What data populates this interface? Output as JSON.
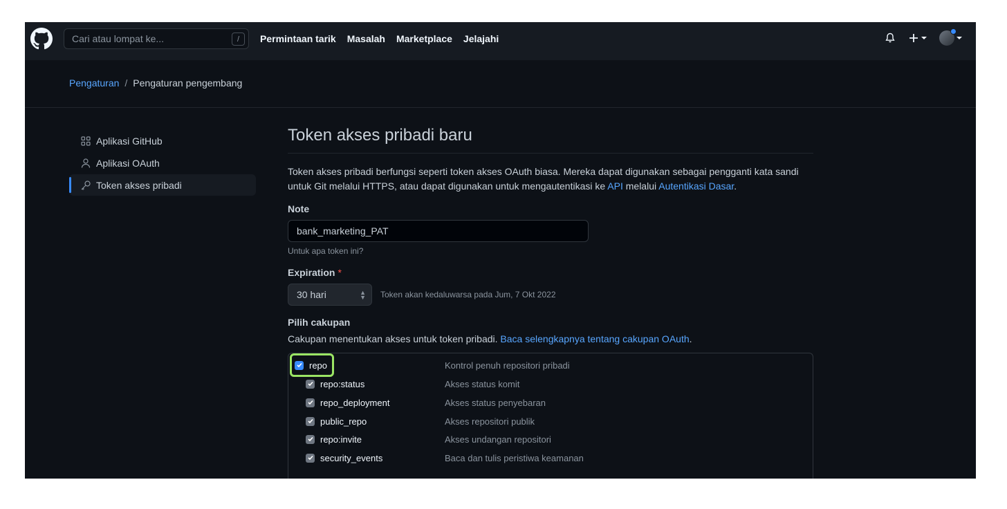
{
  "header": {
    "search_placeholder": "Cari atau lompat ke...",
    "search_shortcut": "/",
    "nav": [
      "Permintaan tarik",
      "Masalah",
      "Marketplace",
      "Jelajahi"
    ]
  },
  "breadcrumb": {
    "parent": "Pengaturan",
    "separator": "/",
    "current": "Pengaturan pengembang"
  },
  "sidebar": {
    "items": [
      {
        "label": "Aplikasi GitHub",
        "icon": "apps-icon",
        "active": false
      },
      {
        "label": "Aplikasi OAuth",
        "icon": "person-icon",
        "active": false
      },
      {
        "label": "Token akses pribadi",
        "icon": "key-icon",
        "active": true
      }
    ]
  },
  "main": {
    "title": "Token akses pribadi baru",
    "intro_text": "Token akses pribadi berfungsi seperti token akses OAuth biasa. Mereka dapat digunakan sebagai pengganti kata sandi untuk Git melalui HTTPS, atau dapat digunakan untuk mengautentikasi ke",
    "intro_link_api": "API",
    "intro_mid": "melalui",
    "intro_link_basic": "Autentikasi Dasar",
    "intro_end": ".",
    "note_label": "Note",
    "note_value": "bank_marketing_PAT",
    "note_hint": "Untuk apa token ini?",
    "expiration_label": "Expiration",
    "required_mark": "*",
    "expiration_value": "30 hari",
    "expiration_note": "Token akan kedaluwarsa pada Jum, 7 Okt 2022",
    "scopes_label": "Pilih cakupan",
    "scopes_lead": "Cakupan menentukan akses untuk token pribadi.",
    "scopes_link": "Baca selengkapnya tentang cakupan OAuth",
    "scopes_lead_end": "."
  },
  "scopes": [
    {
      "name": "repo",
      "desc": "Kontrol penuh repositori pribadi",
      "checked": true,
      "parent": true
    },
    {
      "name": "repo:status",
      "desc": "Akses status komit",
      "checked": true,
      "parent": false
    },
    {
      "name": "repo_deployment",
      "desc": "Akses status penyebaran",
      "checked": true,
      "parent": false
    },
    {
      "name": "public_repo",
      "desc": "Akses repositori publik",
      "checked": true,
      "parent": false
    },
    {
      "name": "repo:invite",
      "desc": "Akses undangan repositori",
      "checked": true,
      "parent": false
    },
    {
      "name": "security_events",
      "desc": "Baca dan tulis peristiwa keamanan",
      "checked": true,
      "parent": false
    }
  ],
  "colors": {
    "accent": "#58a6ff",
    "highlight": "#9be564",
    "background": "#0d1117",
    "header": "#161b22"
  }
}
